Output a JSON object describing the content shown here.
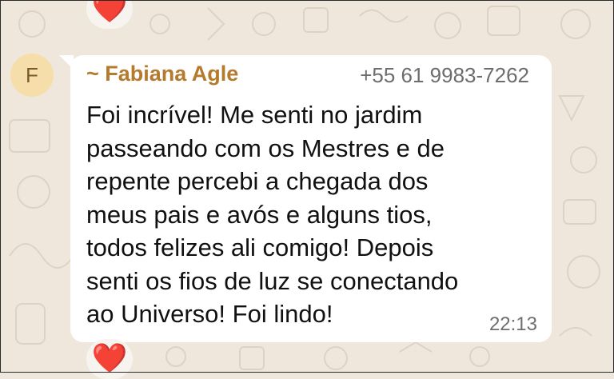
{
  "top_reaction": {
    "emoji": "❤️",
    "icon": "heart-icon"
  },
  "bottom_reaction": {
    "emoji": "❤️",
    "icon": "heart-icon"
  },
  "avatar": {
    "initial": "F"
  },
  "message": {
    "sender": "~ Fabiana Agle",
    "phone": "+55 61 9983-7262",
    "lines": [
      "Foi incrível! Me senti no jardim",
      "passeando com os Mestres e de",
      "repente percebi a chegada dos",
      "meus pais e avós e alguns tios,",
      "todos felizes ali comigo! Depois",
      "senti os fios de luz se conectando",
      "ao Universo! Foi lindo!"
    ],
    "time": "22:13"
  },
  "colors": {
    "background": "#efe7dc",
    "bubble": "#ffffff",
    "sender": "#b57a2c",
    "avatar_bg": "#f6deaa",
    "heart": "#e2243a"
  }
}
